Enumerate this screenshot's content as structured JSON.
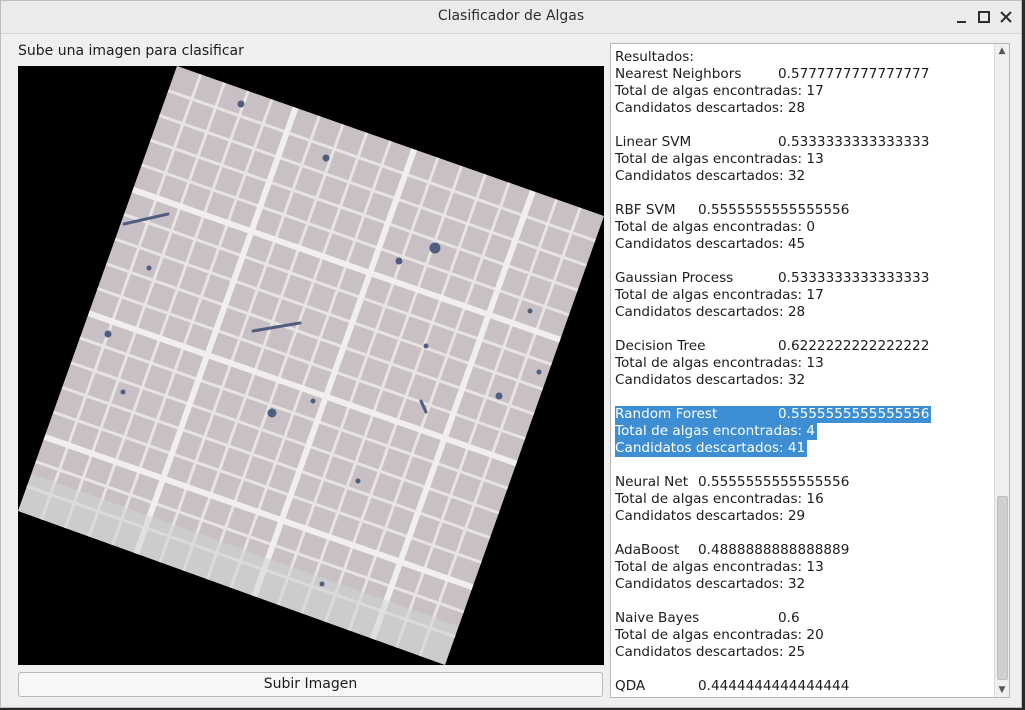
{
  "window": {
    "title": "Clasificador de Algas"
  },
  "main": {
    "prompt_label": "Sube una imagen para clasificar",
    "upload_button": "Subir Imagen"
  },
  "results": {
    "heading": "Resultados:",
    "models": [
      {
        "name": "Nearest Neighbors",
        "score": "0.5777777777777777",
        "found": "Total de algas encontradas: 17",
        "discarded": "Candidatos descartados: 28"
      },
      {
        "name": "Linear SVM",
        "score": "0.5333333333333333",
        "found": "Total de algas encontradas: 13",
        "discarded": "Candidatos descartados: 32"
      },
      {
        "name": "RBF SVM",
        "score": "0.5555555555555556",
        "found": "Total de algas encontradas: 0",
        "discarded": "Candidatos descartados: 45"
      },
      {
        "name": "Gaussian Process",
        "score": "0.5333333333333333",
        "found": "Total de algas encontradas: 17",
        "discarded": "Candidatos descartados: 28"
      },
      {
        "name": "Decision Tree",
        "score": "0.6222222222222222",
        "found": "Total de algas encontradas: 13",
        "discarded": "Candidatos descartados: 32"
      },
      {
        "name": "Random Forest",
        "score": "0.5555555555555556",
        "found": "Total de algas encontradas: 4",
        "discarded": "Candidatos descartados: 41"
      },
      {
        "name": "Neural Net",
        "score": "0.5555555555555556",
        "found": "Total de algas encontradas: 16",
        "discarded": "Candidatos descartados: 29"
      },
      {
        "name": "AdaBoost",
        "score": "0.4888888888888889",
        "found": "Total de algas encontradas: 13",
        "discarded": "Candidatos descartados: 32"
      },
      {
        "name": "Naive Bayes",
        "score": "0.6",
        "found": "Total de algas encontradas: 20",
        "discarded": "Candidatos descartados: 25"
      },
      {
        "name": "QDA",
        "score": "0.4444444444444444"
      }
    ]
  },
  "icons": {
    "minimize": "minimize-icon",
    "maximize": "maximize-icon",
    "close": "close-icon",
    "scroll_up": "arrow-up-icon",
    "scroll_down": "arrow-down-icon"
  },
  "colors": {
    "selection": "#3d8ed2",
    "window_bg": "#efefef"
  }
}
